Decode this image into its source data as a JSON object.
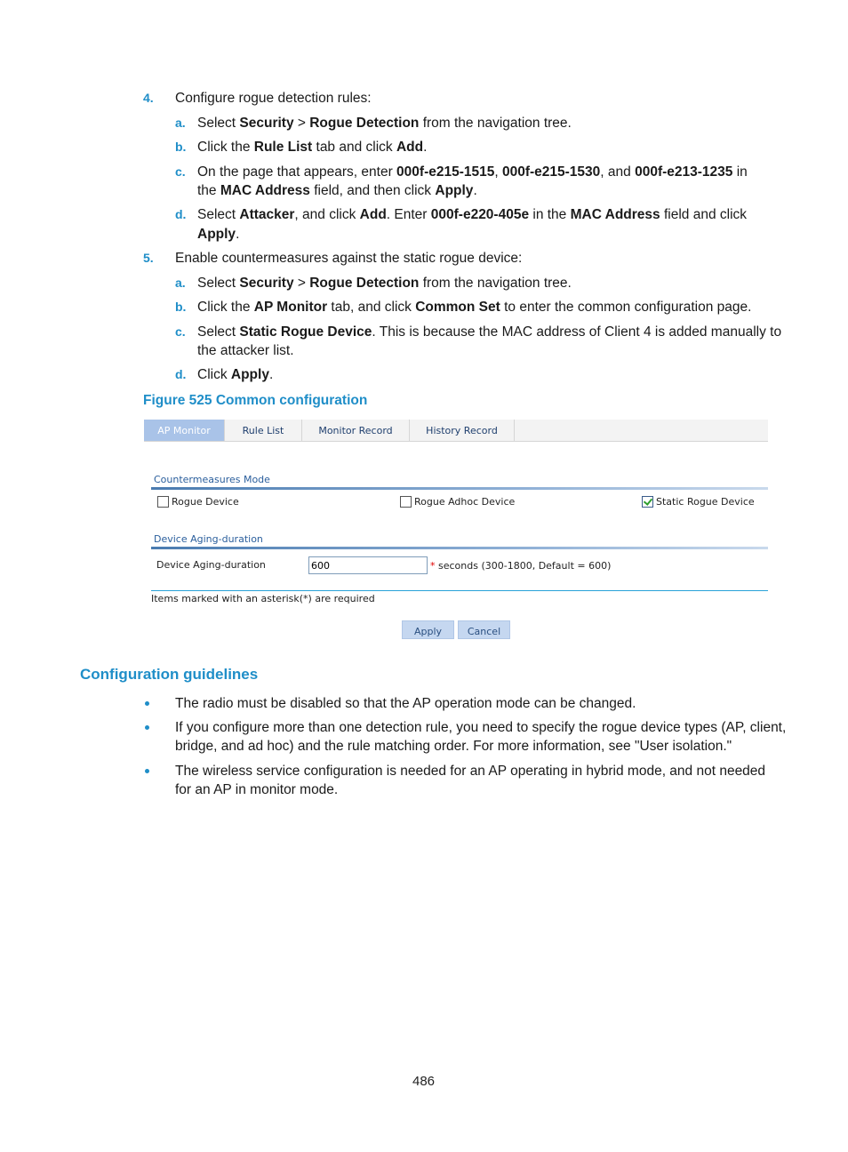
{
  "steps": [
    {
      "number": "4.",
      "text": "Configure rogue detection rules:",
      "substeps": [
        {
          "letter": "a.",
          "parts": [
            [
              "Select ",
              false
            ],
            [
              "Security",
              true
            ],
            [
              " > ",
              false
            ],
            [
              "Rogue Detection",
              true
            ],
            [
              " from the navigation tree.",
              false
            ]
          ]
        },
        {
          "letter": "b.",
          "parts": [
            [
              "Click the ",
              false
            ],
            [
              "Rule List",
              true
            ],
            [
              " tab and click ",
              false
            ],
            [
              "Add",
              true
            ],
            [
              ".",
              false
            ]
          ]
        },
        {
          "letter": "c.",
          "line1": [
            [
              "On the page that appears, enter ",
              false
            ],
            [
              "000f-e215-1515",
              true
            ],
            [
              ", ",
              false
            ],
            [
              "000f-e215-1530",
              true
            ],
            [
              ", and ",
              false
            ],
            [
              "000f-e213-1235",
              true
            ],
            [
              " in",
              false
            ]
          ],
          "line2": [
            [
              "the ",
              false
            ],
            [
              "MAC Address",
              true
            ],
            [
              " field, and then click ",
              false
            ],
            [
              "Apply",
              true
            ],
            [
              ".",
              false
            ]
          ]
        },
        {
          "letter": "d.",
          "line1": [
            [
              "Select ",
              false
            ],
            [
              "Attacker",
              true
            ],
            [
              ", and click ",
              false
            ],
            [
              "Add",
              true
            ],
            [
              ". Enter ",
              false
            ],
            [
              "000f-e220-405e",
              true
            ],
            [
              " in the ",
              false
            ],
            [
              "MAC Address",
              true
            ],
            [
              " field and click",
              false
            ]
          ],
          "line2": [
            [
              "Apply",
              true
            ],
            [
              ".",
              false
            ]
          ]
        }
      ]
    },
    {
      "number": "5.",
      "text": "Enable countermeasures against the static rogue device:",
      "substeps": [
        {
          "letter": "a.",
          "parts": [
            [
              "Select ",
              false
            ],
            [
              "Security",
              true
            ],
            [
              " > ",
              false
            ],
            [
              "Rogue Detection",
              true
            ],
            [
              " from the navigation tree.",
              false
            ]
          ]
        },
        {
          "letter": "b.",
          "parts": [
            [
              "Click the ",
              false
            ],
            [
              "AP Monitor",
              true
            ],
            [
              " tab, and click ",
              false
            ],
            [
              "Common Set",
              true
            ],
            [
              " to enter the common configuration page.",
              false
            ]
          ]
        },
        {
          "letter": "c.",
          "line1": [
            [
              "Select ",
              false
            ],
            [
              "Static Rogue Device",
              true
            ],
            [
              ". This is because the MAC address of Client 4 is added manually to",
              false
            ]
          ],
          "line2": [
            [
              "the attacker list.",
              false
            ]
          ]
        },
        {
          "letter": "d.",
          "parts": [
            [
              "Click ",
              false
            ],
            [
              "Apply",
              true
            ],
            [
              ".",
              false
            ]
          ]
        }
      ]
    }
  ],
  "figure": {
    "caption": "Figure 525 Common configuration",
    "tabs": [
      {
        "label": "AP Monitor",
        "active": true
      },
      {
        "label": "Rule List",
        "active": false
      },
      {
        "label": "Monitor Record",
        "active": false
      },
      {
        "label": "History Record",
        "active": false
      }
    ],
    "countermeasures": {
      "section_label": "Countermeasures Mode",
      "options": [
        {
          "label": "Rogue Device",
          "checked": false
        },
        {
          "label": "Rogue Adhoc Device",
          "checked": false
        },
        {
          "label": "Static Rogue Device",
          "checked": true
        }
      ]
    },
    "aging": {
      "section_label": "Device Aging-duration",
      "field_label": "Device Aging-duration",
      "value": "600",
      "required_mark": "*",
      "hint": " seconds (300-1800, Default = 600)"
    },
    "required_note": "Items marked with an asterisk(*) are required",
    "buttons": {
      "apply": "Apply",
      "cancel": "Cancel"
    },
    "colors": {
      "active_tab": "#a9c3e8",
      "button": "#c5d7f0",
      "section_text": "#2a5e9c",
      "asterisk": "#e00000"
    }
  },
  "guidelines": {
    "title": "Configuration guidelines",
    "items": [
      {
        "line1": "The radio must be disabled so that the AP operation mode can be changed."
      },
      {
        "line1": "If you configure more than one detection rule, you need to specify the rogue device types (AP, client,",
        "line2": "bridge, and ad hoc) and the rule matching order. For more information, see \"User isolation.\""
      },
      {
        "line1": "The wireless service configuration is needed for an AP operating in hybrid mode, and not needed",
        "line2": "for an AP in monitor mode."
      }
    ]
  },
  "page_number": "486",
  "accent_color": "#1f8ec8"
}
